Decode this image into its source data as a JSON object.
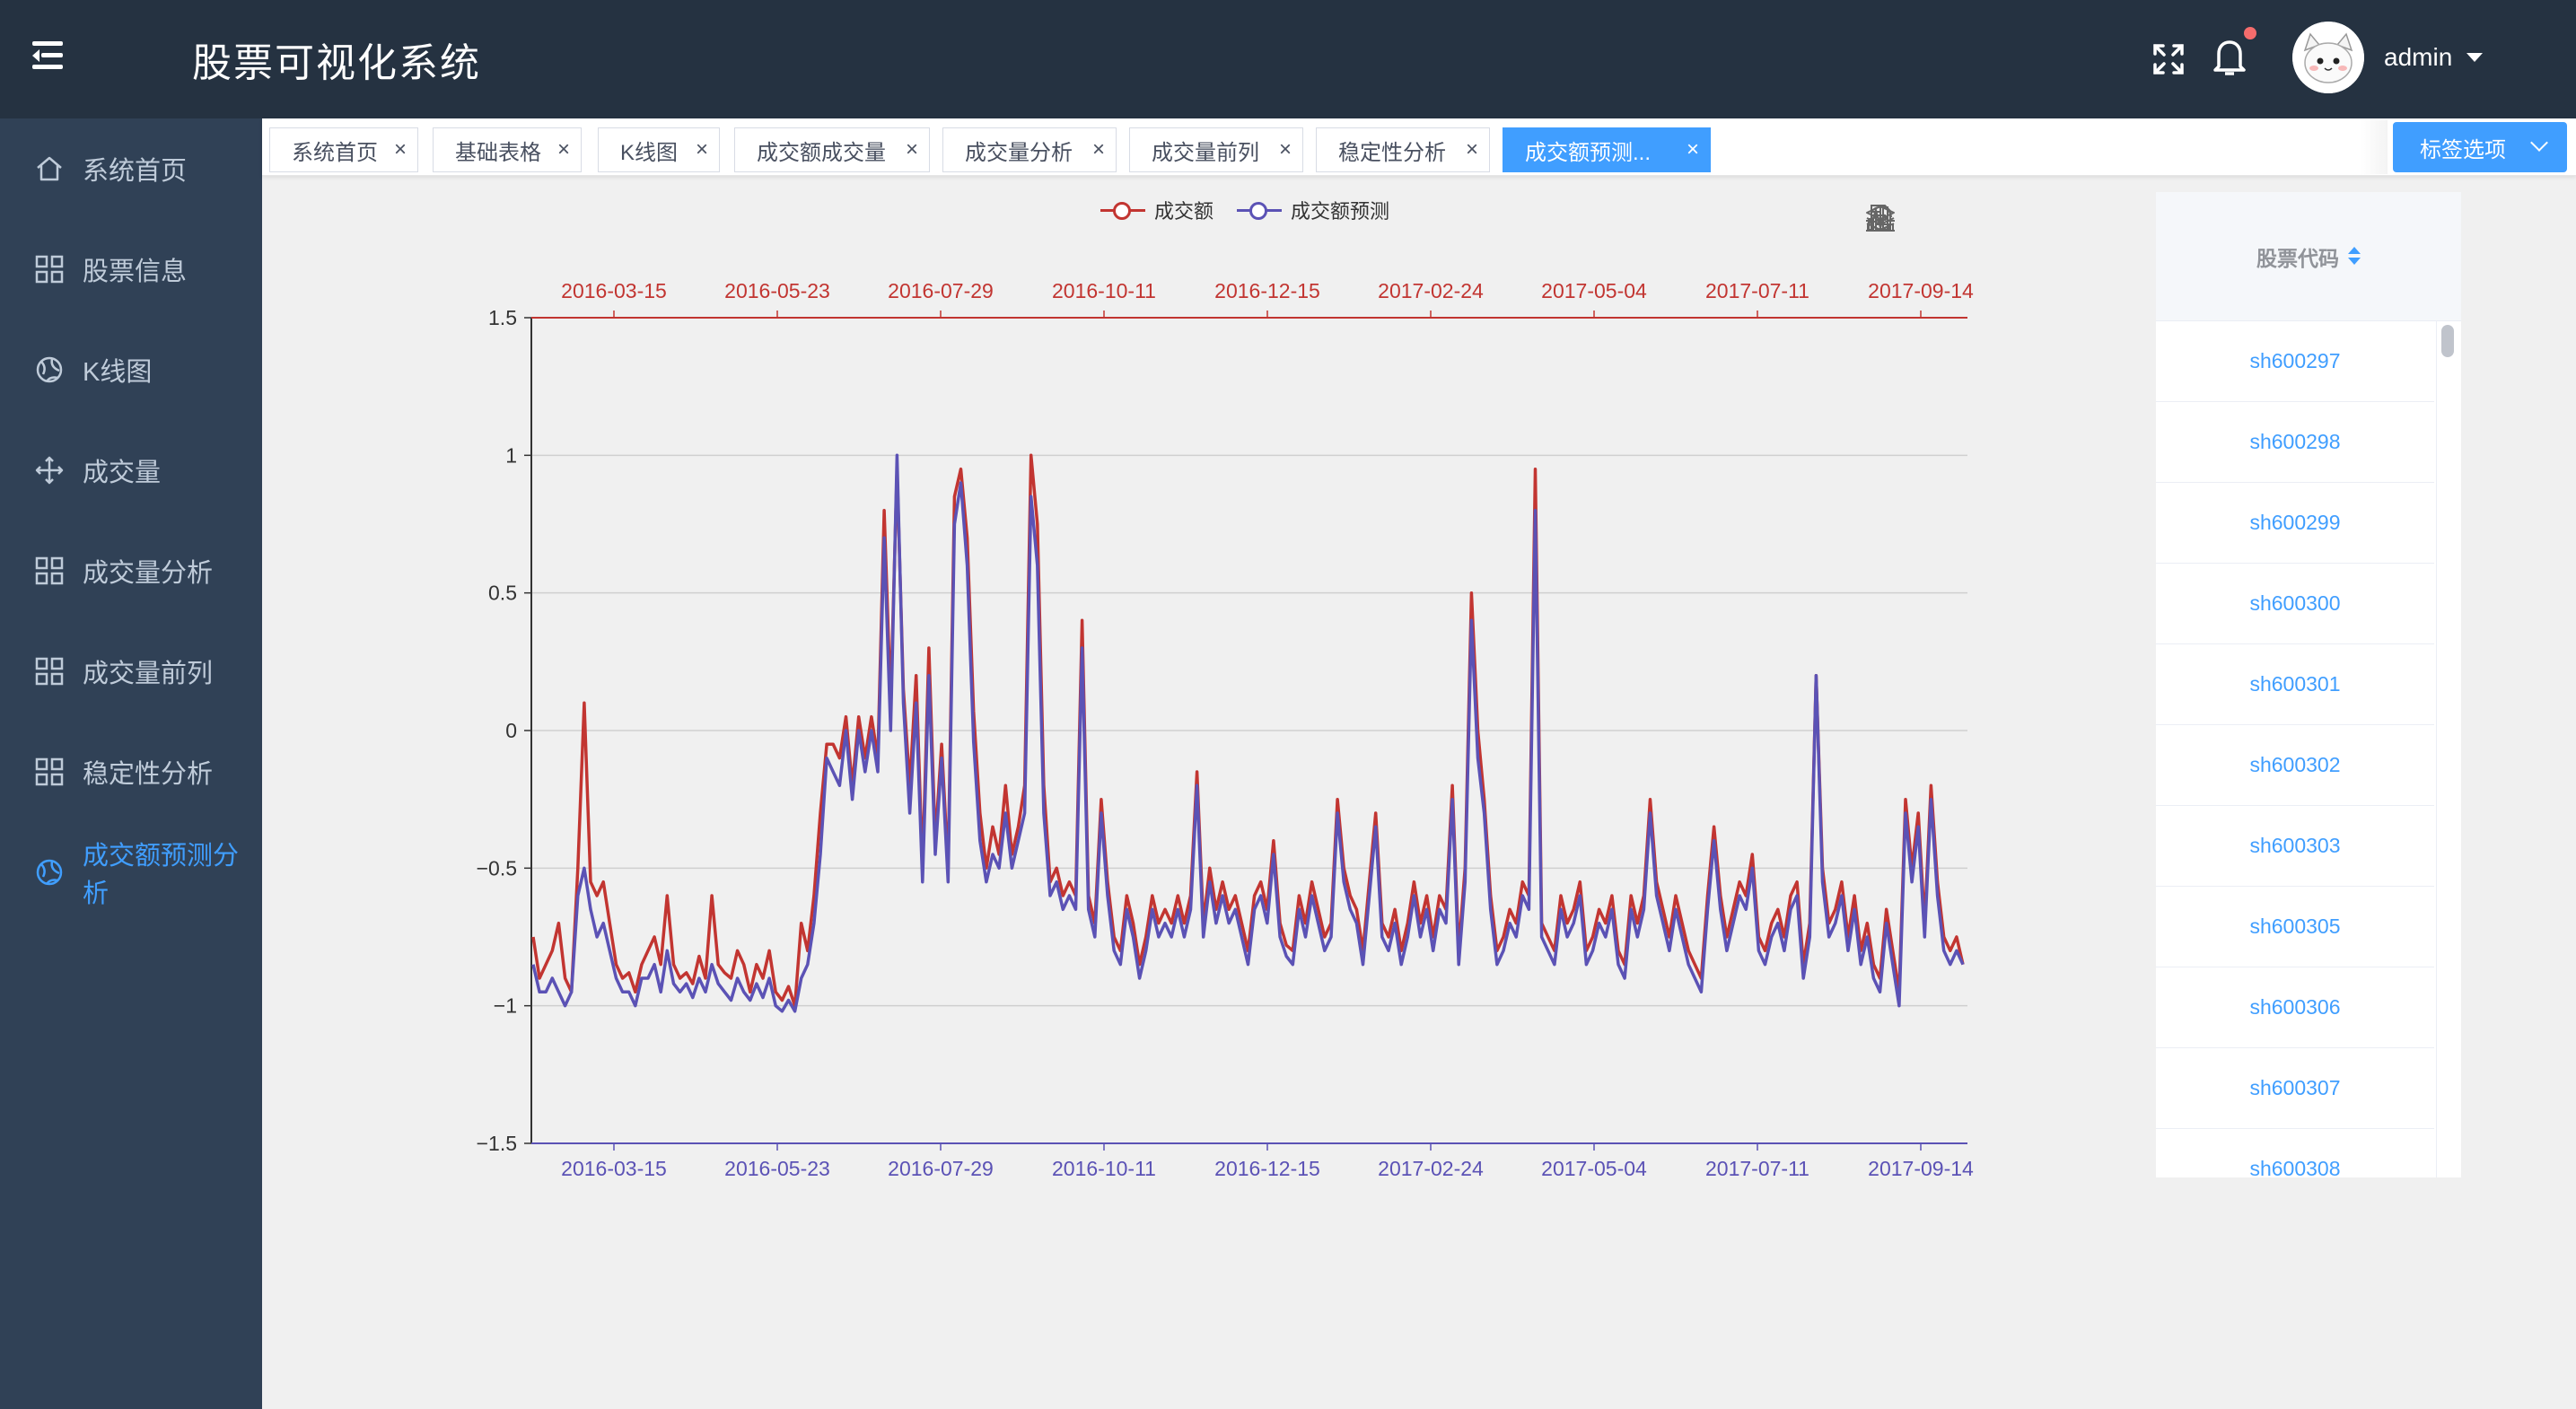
{
  "header": {
    "app_title": "股票可视化系统",
    "username": "admin",
    "icons": [
      "hamburger-icon",
      "fullscreen-icon",
      "bell-icon",
      "avatar",
      "caret-down-icon"
    ]
  },
  "sidebar": {
    "items": [
      {
        "label": "系统首页",
        "icon": "home-icon",
        "active": false
      },
      {
        "label": "股票信息",
        "icon": "grid-icon",
        "active": false
      },
      {
        "label": "K线图",
        "icon": "globe-icon",
        "active": false
      },
      {
        "label": "成交量",
        "icon": "move-icon",
        "active": false
      },
      {
        "label": "成交量分析",
        "icon": "grid-icon",
        "active": false
      },
      {
        "label": "成交量前列",
        "icon": "grid-icon",
        "active": false
      },
      {
        "label": "稳定性分析",
        "icon": "grid-icon",
        "active": false
      },
      {
        "label": "成交额预测分析",
        "icon": "globe-icon",
        "active": true
      }
    ]
  },
  "tags": {
    "items": [
      {
        "label": "系统首页",
        "active": false
      },
      {
        "label": "基础表格",
        "active": false
      },
      {
        "label": "K线图",
        "active": false
      },
      {
        "label": "成交额成交量",
        "active": false
      },
      {
        "label": "成交量分析",
        "active": false
      },
      {
        "label": "成交量前列",
        "active": false
      },
      {
        "label": "稳定性分析",
        "active": false
      },
      {
        "label": "成交额预测...",
        "active": true
      }
    ],
    "close_glyph": "×",
    "options_label": "标签选项"
  },
  "toolbox": {
    "icons": [
      "data-view-icon",
      "restore-icon",
      "line-chart-icon",
      "bar-chart-icon",
      "stack-icon",
      "save-image-icon"
    ]
  },
  "chart_data": {
    "type": "line",
    "legend": [
      "成交额",
      "成交额预测"
    ],
    "x_tick_labels": [
      "2016-03-15",
      "2016-05-23",
      "2016-07-29",
      "2016-10-11",
      "2016-12-15",
      "2017-02-24",
      "2017-05-04",
      "2017-07-11",
      "2017-09-14"
    ],
    "y_tick_labels": [
      "1.5",
      "1",
      "0.5",
      "0",
      "−0.5",
      "−1",
      "−1.5"
    ],
    "ylim": [
      -1.5,
      1.5
    ],
    "grid": true,
    "colors": {
      "actual": "#c23531",
      "predicted": "#5b52b5"
    },
    "series": [
      {
        "name": "成交额",
        "color": "#c23531",
        "values": [
          -0.75,
          -0.9,
          -0.85,
          -0.8,
          -0.7,
          -0.9,
          -0.95,
          -0.5,
          0.1,
          -0.55,
          -0.6,
          -0.55,
          -0.7,
          -0.85,
          -0.9,
          -0.88,
          -0.95,
          -0.85,
          -0.8,
          -0.75,
          -0.85,
          -0.6,
          -0.85,
          -0.9,
          -0.88,
          -0.92,
          -0.82,
          -0.9,
          -0.6,
          -0.85,
          -0.88,
          -0.9,
          -0.8,
          -0.85,
          -0.95,
          -0.85,
          -0.9,
          -0.8,
          -0.95,
          -0.98,
          -0.93,
          -1.0,
          -0.7,
          -0.8,
          -0.6,
          -0.3,
          -0.05,
          -0.05,
          -0.1,
          0.05,
          -0.2,
          0.05,
          -0.1,
          0.05,
          -0.1,
          0.8,
          0.1,
          0.95,
          0.15,
          -0.2,
          0.2,
          -0.5,
          0.3,
          -0.4,
          -0.05,
          -0.5,
          0.85,
          0.95,
          0.7,
          0.07,
          -0.3,
          -0.5,
          -0.35,
          -0.45,
          -0.2,
          -0.45,
          -0.35,
          -0.2,
          1.0,
          0.75,
          -0.2,
          -0.55,
          -0.5,
          -0.6,
          -0.55,
          -0.6,
          0.4,
          -0.6,
          -0.7,
          -0.25,
          -0.55,
          -0.75,
          -0.8,
          -0.6,
          -0.7,
          -0.85,
          -0.75,
          -0.6,
          -0.7,
          -0.65,
          -0.7,
          -0.6,
          -0.7,
          -0.6,
          -0.15,
          -0.7,
          -0.5,
          -0.65,
          -0.55,
          -0.65,
          -0.6,
          -0.7,
          -0.8,
          -0.6,
          -0.55,
          -0.65,
          -0.4,
          -0.7,
          -0.78,
          -0.8,
          -0.6,
          -0.7,
          -0.55,
          -0.65,
          -0.75,
          -0.7,
          -0.25,
          -0.5,
          -0.6,
          -0.65,
          -0.8,
          -0.55,
          -0.3,
          -0.7,
          -0.75,
          -0.65,
          -0.8,
          -0.7,
          -0.55,
          -0.7,
          -0.6,
          -0.75,
          -0.6,
          -0.65,
          -0.2,
          -0.8,
          -0.5,
          0.5,
          0.0,
          -0.25,
          -0.6,
          -0.8,
          -0.75,
          -0.65,
          -0.7,
          -0.55,
          -0.6,
          0.95,
          -0.7,
          -0.75,
          -0.8,
          -0.6,
          -0.7,
          -0.65,
          -0.55,
          -0.8,
          -0.75,
          -0.65,
          -0.7,
          -0.6,
          -0.8,
          -0.85,
          -0.6,
          -0.7,
          -0.6,
          -0.25,
          -0.55,
          -0.65,
          -0.75,
          -0.6,
          -0.7,
          -0.8,
          -0.85,
          -0.9,
          -0.6,
          -0.35,
          -0.6,
          -0.75,
          -0.65,
          -0.55,
          -0.6,
          -0.45,
          -0.75,
          -0.8,
          -0.7,
          -0.65,
          -0.75,
          -0.6,
          -0.55,
          -0.85,
          -0.7,
          0.2,
          -0.5,
          -0.7,
          -0.65,
          -0.55,
          -0.75,
          -0.6,
          -0.8,
          -0.7,
          -0.85,
          -0.9,
          -0.65,
          -0.8,
          -0.95,
          -0.25,
          -0.5,
          -0.3,
          -0.7,
          -0.2,
          -0.55,
          -0.75,
          -0.8,
          -0.75,
          -0.85
        ]
      },
      {
        "name": "成交额预测",
        "color": "#5b52b5",
        "values": [
          -0.85,
          -0.95,
          -0.95,
          -0.9,
          -0.95,
          -1.0,
          -0.95,
          -0.6,
          -0.5,
          -0.65,
          -0.75,
          -0.7,
          -0.8,
          -0.9,
          -0.95,
          -0.95,
          -1.0,
          -0.9,
          -0.9,
          -0.85,
          -0.95,
          -0.8,
          -0.92,
          -0.95,
          -0.92,
          -0.97,
          -0.9,
          -0.95,
          -0.85,
          -0.92,
          -0.95,
          -0.98,
          -0.9,
          -0.95,
          -0.98,
          -0.92,
          -0.97,
          -0.9,
          -1.0,
          -1.02,
          -0.98,
          -1.02,
          -0.9,
          -0.85,
          -0.7,
          -0.45,
          -0.1,
          -0.15,
          -0.2,
          0.0,
          -0.25,
          0.0,
          -0.15,
          0.0,
          -0.15,
          0.7,
          0.0,
          1.0,
          0.1,
          -0.3,
          0.1,
          -0.55,
          0.2,
          -0.45,
          -0.1,
          -0.55,
          0.75,
          0.9,
          0.6,
          -0.04,
          -0.4,
          -0.55,
          -0.45,
          -0.5,
          -0.3,
          -0.5,
          -0.4,
          -0.3,
          0.85,
          0.6,
          -0.3,
          -0.6,
          -0.55,
          -0.65,
          -0.6,
          -0.65,
          0.3,
          -0.65,
          -0.75,
          -0.3,
          -0.6,
          -0.8,
          -0.85,
          -0.65,
          -0.75,
          -0.9,
          -0.8,
          -0.65,
          -0.75,
          -0.7,
          -0.75,
          -0.65,
          -0.75,
          -0.65,
          -0.2,
          -0.75,
          -0.55,
          -0.7,
          -0.6,
          -0.7,
          -0.65,
          -0.75,
          -0.85,
          -0.65,
          -0.6,
          -0.7,
          -0.45,
          -0.75,
          -0.82,
          -0.85,
          -0.65,
          -0.75,
          -0.6,
          -0.7,
          -0.8,
          -0.75,
          -0.3,
          -0.55,
          -0.65,
          -0.7,
          -0.85,
          -0.6,
          -0.35,
          -0.75,
          -0.8,
          -0.7,
          -0.85,
          -0.75,
          -0.6,
          -0.75,
          -0.65,
          -0.8,
          -0.65,
          -0.7,
          -0.25,
          -0.85,
          -0.55,
          0.4,
          -0.1,
          -0.3,
          -0.65,
          -0.85,
          -0.8,
          -0.7,
          -0.75,
          -0.6,
          -0.65,
          0.8,
          -0.75,
          -0.8,
          -0.85,
          -0.65,
          -0.75,
          -0.7,
          -0.6,
          -0.85,
          -0.8,
          -0.7,
          -0.75,
          -0.65,
          -0.85,
          -0.9,
          -0.65,
          -0.75,
          -0.65,
          -0.3,
          -0.6,
          -0.7,
          -0.8,
          -0.65,
          -0.75,
          -0.85,
          -0.9,
          -0.95,
          -0.65,
          -0.4,
          -0.65,
          -0.8,
          -0.7,
          -0.6,
          -0.65,
          -0.5,
          -0.8,
          -0.85,
          -0.75,
          -0.7,
          -0.8,
          -0.65,
          -0.6,
          -0.9,
          -0.75,
          0.2,
          -0.55,
          -0.75,
          -0.7,
          -0.6,
          -0.8,
          -0.65,
          -0.85,
          -0.75,
          -0.9,
          -0.95,
          -0.7,
          -0.85,
          -1.0,
          -0.3,
          -0.55,
          -0.35,
          -0.75,
          -0.25,
          -0.6,
          -0.8,
          -0.85,
          -0.8,
          -0.85
        ]
      }
    ]
  },
  "stock_table": {
    "header": "股票代码",
    "rows": [
      "sh600297",
      "sh600298",
      "sh600299",
      "sh600300",
      "sh600301",
      "sh600302",
      "sh600303",
      "sh600305",
      "sh600306",
      "sh600307",
      "sh600308"
    ]
  }
}
